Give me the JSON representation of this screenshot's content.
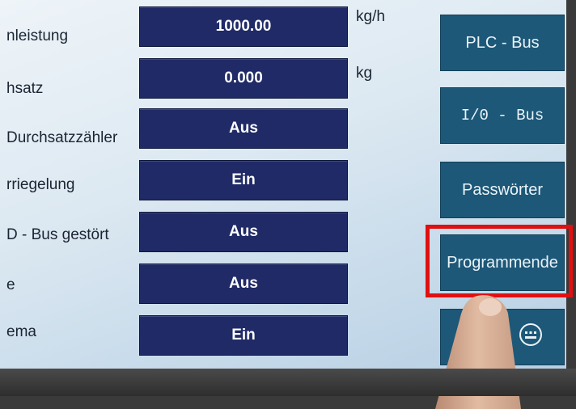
{
  "rows": [
    {
      "label": "nleistung",
      "value": "1000.00",
      "unit": "kg/h"
    },
    {
      "label": "hsatz",
      "value": "0.000",
      "unit": "kg"
    },
    {
      "label": "Durchsatzzähler",
      "value": "Aus"
    },
    {
      "label": "rriegelung",
      "value": "Ein"
    },
    {
      "label": "D - Bus gestört",
      "value": "Aus"
    },
    {
      "label": "e",
      "value": "Aus"
    },
    {
      "label": "ema",
      "value": "Ein"
    }
  ],
  "side_buttons": [
    {
      "label": "PLC - Bus"
    },
    {
      "label": "I/0 - Bus"
    },
    {
      "label": "Passwörter"
    },
    {
      "label": "Programmende"
    }
  ],
  "colors": {
    "value_button_bg": "#1f2a66",
    "side_button_bg": "#1d5878",
    "highlight_border": "#e01010"
  },
  "icons": {
    "bottom_button": "keyboard-icon"
  }
}
